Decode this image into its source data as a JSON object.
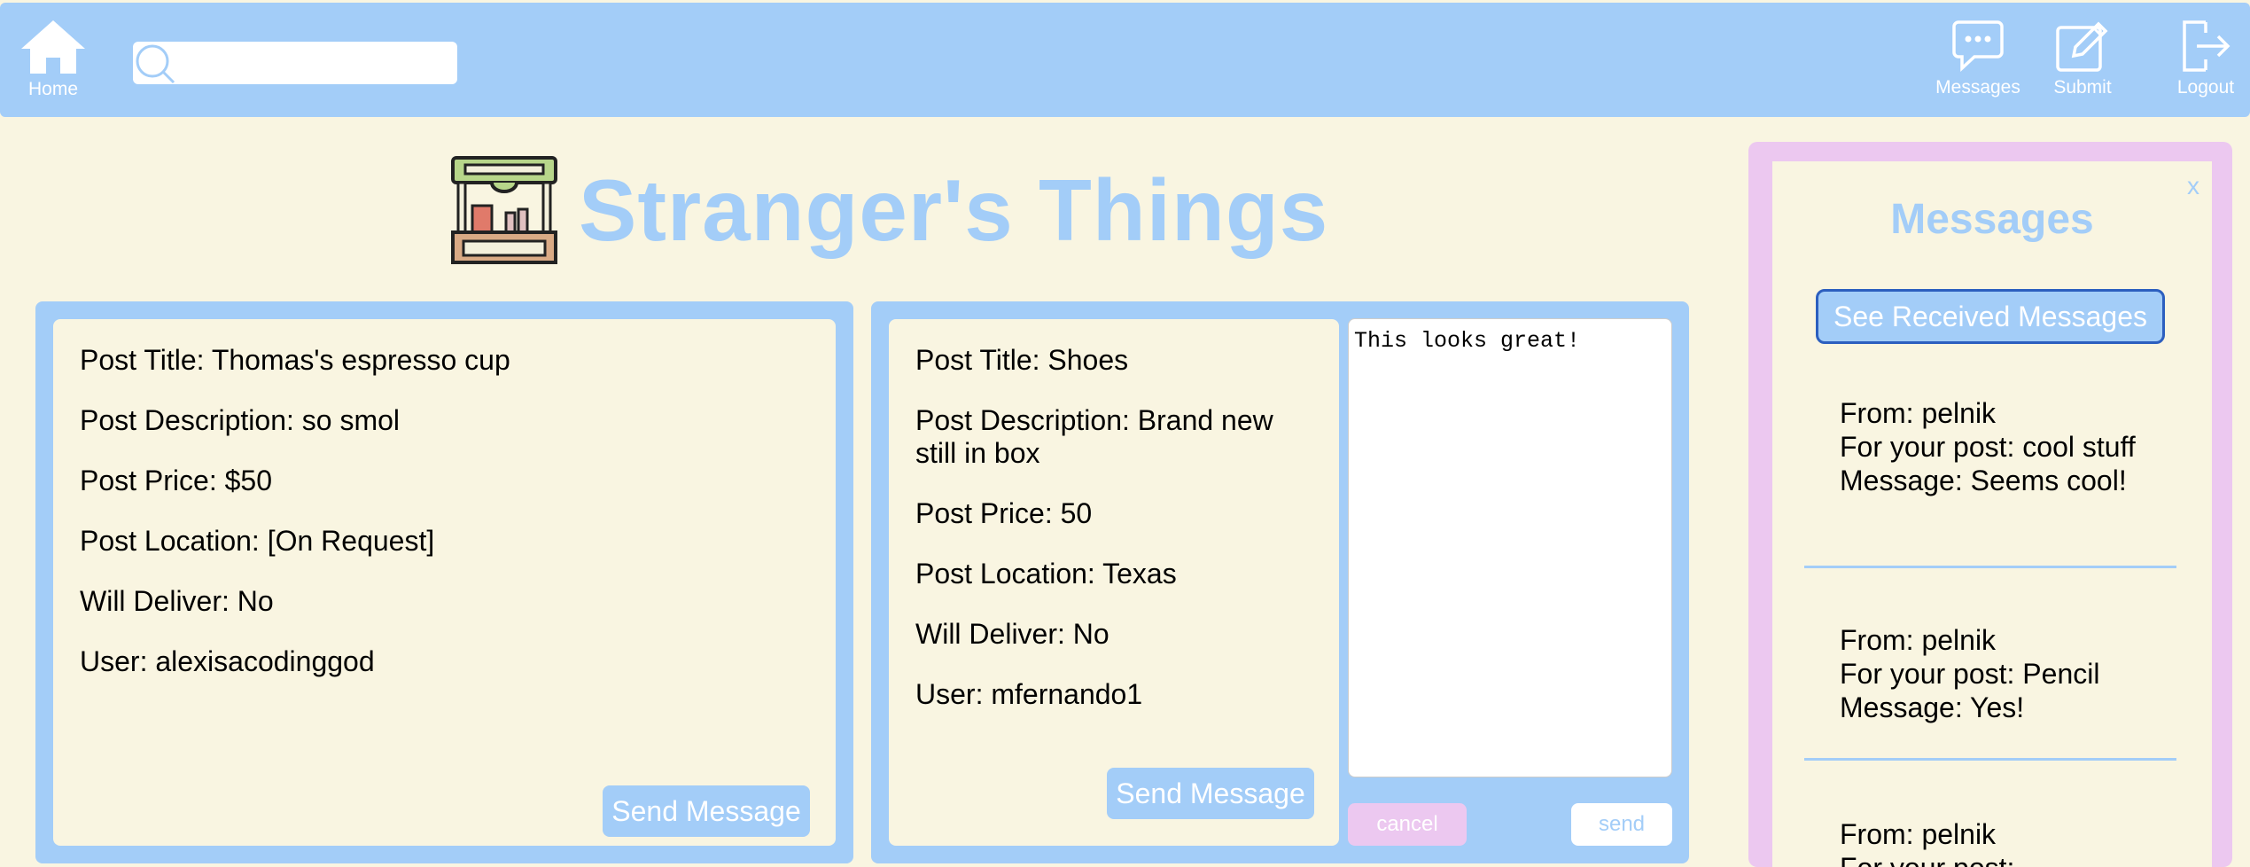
{
  "nav": {
    "home_label": "Home",
    "messages_label": "Messages",
    "submit_label": "Submit",
    "logout_label": "Logout",
    "search_placeholder": ""
  },
  "header": {
    "title": "Stranger's Things"
  },
  "posts": [
    {
      "title": "Post Title: Thomas's espresso cup",
      "description": "Post Description: so smol",
      "price": "Post Price: $50",
      "location": "Post Location: [On Request]",
      "deliver": "Will Deliver: No",
      "user": "User: alexisacodinggod",
      "send_label": "Send Message"
    },
    {
      "title": "Post Title: Shoes",
      "description": "Post Description: Brand new still in box",
      "price": "Post Price: 50",
      "location": "Post Location: Texas",
      "deliver": "Will Deliver: No",
      "user": "User: mfernando1",
      "send_label": "Send Message"
    }
  ],
  "compose": {
    "text": "This looks great!",
    "cancel_label": "cancel",
    "send_label": "send"
  },
  "messages_panel": {
    "close_label": "x",
    "title": "Messages",
    "received_button": "See Received Messages",
    "items": [
      {
        "from": "From: pelnik",
        "post": "For your post: cool stuff",
        "message": "Message: Seems cool!"
      },
      {
        "from": "From: pelnik",
        "post": "For your post: Pencil",
        "message": "Message: Yes!"
      },
      {
        "from": "From: pelnik",
        "post": "For your post:",
        "message": ""
      }
    ]
  },
  "colors": {
    "primary_blue": "#a3cdf8",
    "background_cream": "#f9f5e1",
    "accent_pink": "#ecc8f0",
    "button_border": "#2c5fbf"
  }
}
